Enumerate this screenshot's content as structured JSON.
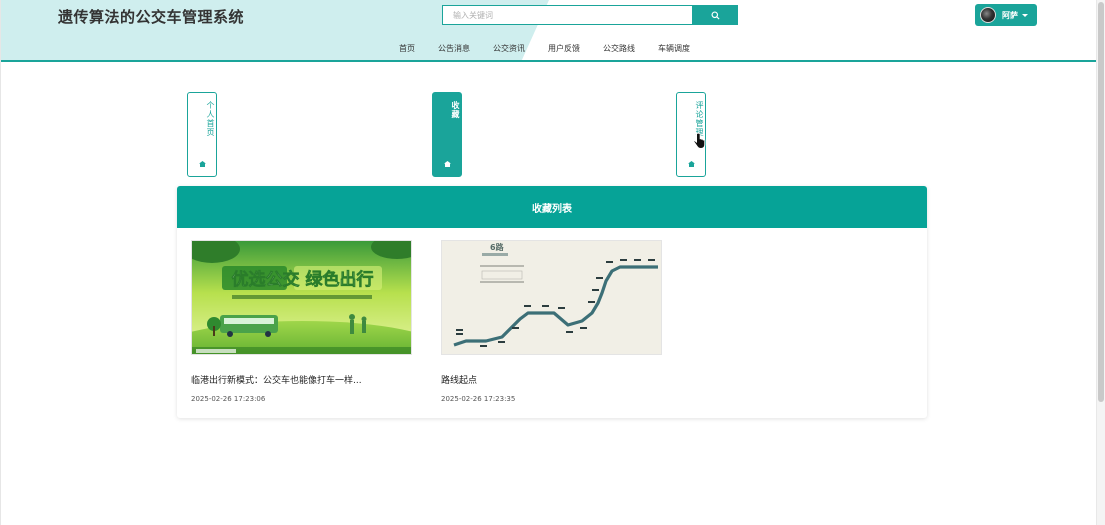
{
  "header": {
    "title": "遗传算法的公交车管理系统",
    "search_placeholder": "输入关键词",
    "user_name": "阿萨",
    "accent_color": "#1aa49a"
  },
  "nav": {
    "items": [
      {
        "label": "首页"
      },
      {
        "label": "公告消息"
      },
      {
        "label": "公交资讯"
      },
      {
        "label": "用户反馈"
      },
      {
        "label": "公交路线"
      },
      {
        "label": "车辆调度"
      }
    ]
  },
  "tabs": {
    "profile": {
      "label": "个人首页",
      "icon": "home-icon"
    },
    "favorites": {
      "label": "收藏",
      "icon": "home-icon"
    },
    "comments": {
      "label": "评论管理",
      "icon": "home-icon"
    }
  },
  "favorites": {
    "heading": "收藏列表",
    "items": [
      {
        "title": "临港出行新模式：公交车也能像打车一样...",
        "date": "2025-02-26 17:23:06",
        "banner_text": "优选公交 绿色出行"
      },
      {
        "title": "路线起点",
        "date": "2025-02-26 17:23:35",
        "map_label": "6路"
      }
    ]
  }
}
